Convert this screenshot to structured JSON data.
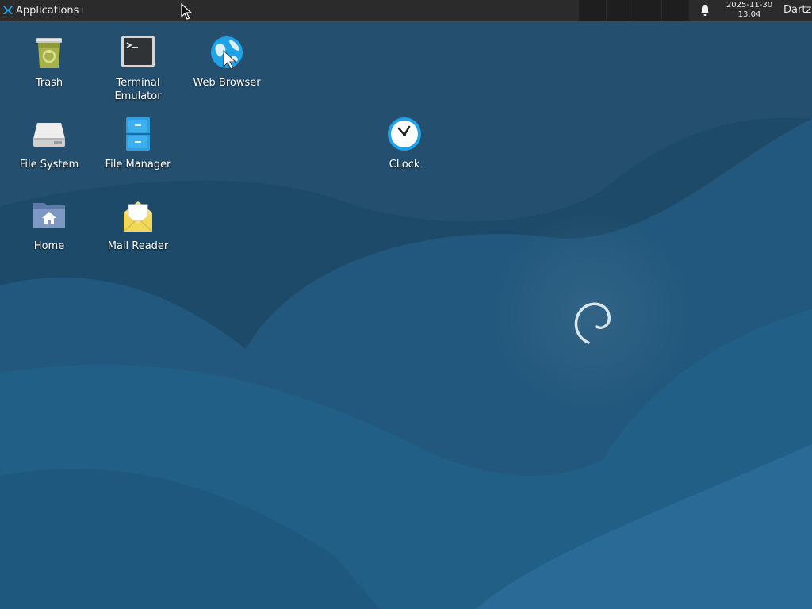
{
  "panel": {
    "app_menu_label": "Applications",
    "date": "2025-11-30",
    "time": "13:04",
    "user": "Dartz",
    "notification_icon": "bell-icon",
    "workspace_count": 4
  },
  "desktop": {
    "icons": [
      {
        "id": "trash",
        "label": "Trash",
        "icon": "trash-icon"
      },
      {
        "id": "terminal",
        "label": "Terminal Emulator",
        "icon": "terminal-icon"
      },
      {
        "id": "web-browser",
        "label": "Web Browser",
        "icon": "web-browser-icon"
      },
      {
        "id": "file-system",
        "label": "File System",
        "icon": "drive-icon"
      },
      {
        "id": "file-manager",
        "label": "File Manager",
        "icon": "file-cabinet-icon"
      },
      {
        "id": "clock",
        "label": "CLock",
        "icon": "clock-icon"
      },
      {
        "id": "home",
        "label": "Home",
        "icon": "home-folder-icon"
      },
      {
        "id": "mail-reader",
        "label": "Mail Reader",
        "icon": "mail-icon"
      }
    ]
  },
  "colors": {
    "panel_bg": "#2b2b2b",
    "desktop_bg": "#1f4e6e",
    "icon_label": "#ffffff",
    "accent": "#1fa3e8"
  }
}
